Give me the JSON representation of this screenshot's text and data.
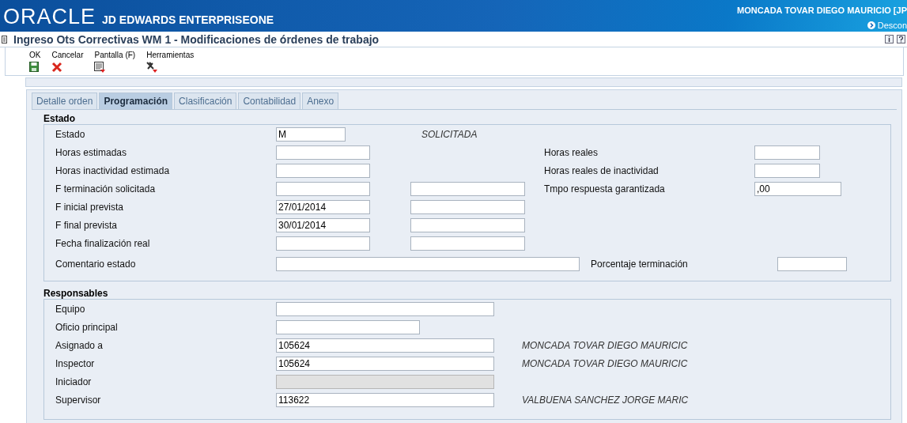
{
  "header": {
    "logo": "ORACLE",
    "product": "JD EDWARDS ENTERPRISEONE",
    "user": "MONCADA TOVAR DIEGO MAURICIO  [JP",
    "signout": "Descon"
  },
  "form_title": "Ingreso Ots Correctivas WM 1 - Modificaciones de órdenes de trabajo",
  "toolbar": [
    {
      "label": "OK",
      "kind": "save"
    },
    {
      "label": "Cancelar",
      "kind": "cancel"
    },
    {
      "label": "Pantalla (F)",
      "kind": "form"
    },
    {
      "label": "Herramientas",
      "kind": "tools"
    }
  ],
  "tabs": [
    {
      "label": "Detalle orden",
      "selected": false
    },
    {
      "label": "Programación",
      "selected": true
    },
    {
      "label": "Clasificación",
      "selected": false
    },
    {
      "label": "Contabilidad",
      "selected": false
    },
    {
      "label": "Anexo",
      "selected": false
    }
  ],
  "estado": {
    "title": "Estado",
    "rows": [
      {
        "kind": "status",
        "label": "Estado",
        "value": "M",
        "description": "SOLICITADA"
      },
      {
        "kind": "standard",
        "label": "Horas estimadas",
        "second_field": false,
        "right_label": "Horas reales"
      },
      {
        "kind": "standard",
        "label": "Horas inactividad estimada",
        "second_field": false,
        "right_label": "Horas reales de inactividad"
      },
      {
        "kind": "standard",
        "label": "F terminación solicitada",
        "second_field": true,
        "right_label": "Tmpo respuesta garantizada",
        "right_value": ",00"
      },
      {
        "kind": "standard",
        "label": "F inicial prevista",
        "value": "27/01/2014",
        "second_field": true
      },
      {
        "kind": "standard",
        "label": "F final prevista",
        "value": "30/01/2014",
        "second_field": true
      },
      {
        "kind": "standard",
        "label": "Fecha finalización real",
        "second_field": true
      },
      {
        "kind": "comment",
        "label": "Comentario estado",
        "right_label": "Porcentaje terminación"
      }
    ]
  },
  "responsables": {
    "title": "Responsables",
    "rows": [
      {
        "kind": "wide",
        "label": "Equipo",
        "disabled": false
      },
      {
        "kind": "short",
        "label": "Oficio principal",
        "disabled": false
      },
      {
        "kind": "wide",
        "label": "Asignado a",
        "value": "105624",
        "disabled": false,
        "description": "MONCADA TOVAR DIEGO MAURICIC"
      },
      {
        "kind": "wide",
        "label": "Inspector",
        "value": "105624",
        "disabled": false,
        "description": "MONCADA TOVAR DIEGO MAURICIC"
      },
      {
        "kind": "wide",
        "label": "Iniciador",
        "disabled": true
      },
      {
        "kind": "wide",
        "label": "Supervisor",
        "value": "113622",
        "disabled": false,
        "description": "VALBUENA SANCHEZ JORGE MARIC"
      }
    ]
  }
}
